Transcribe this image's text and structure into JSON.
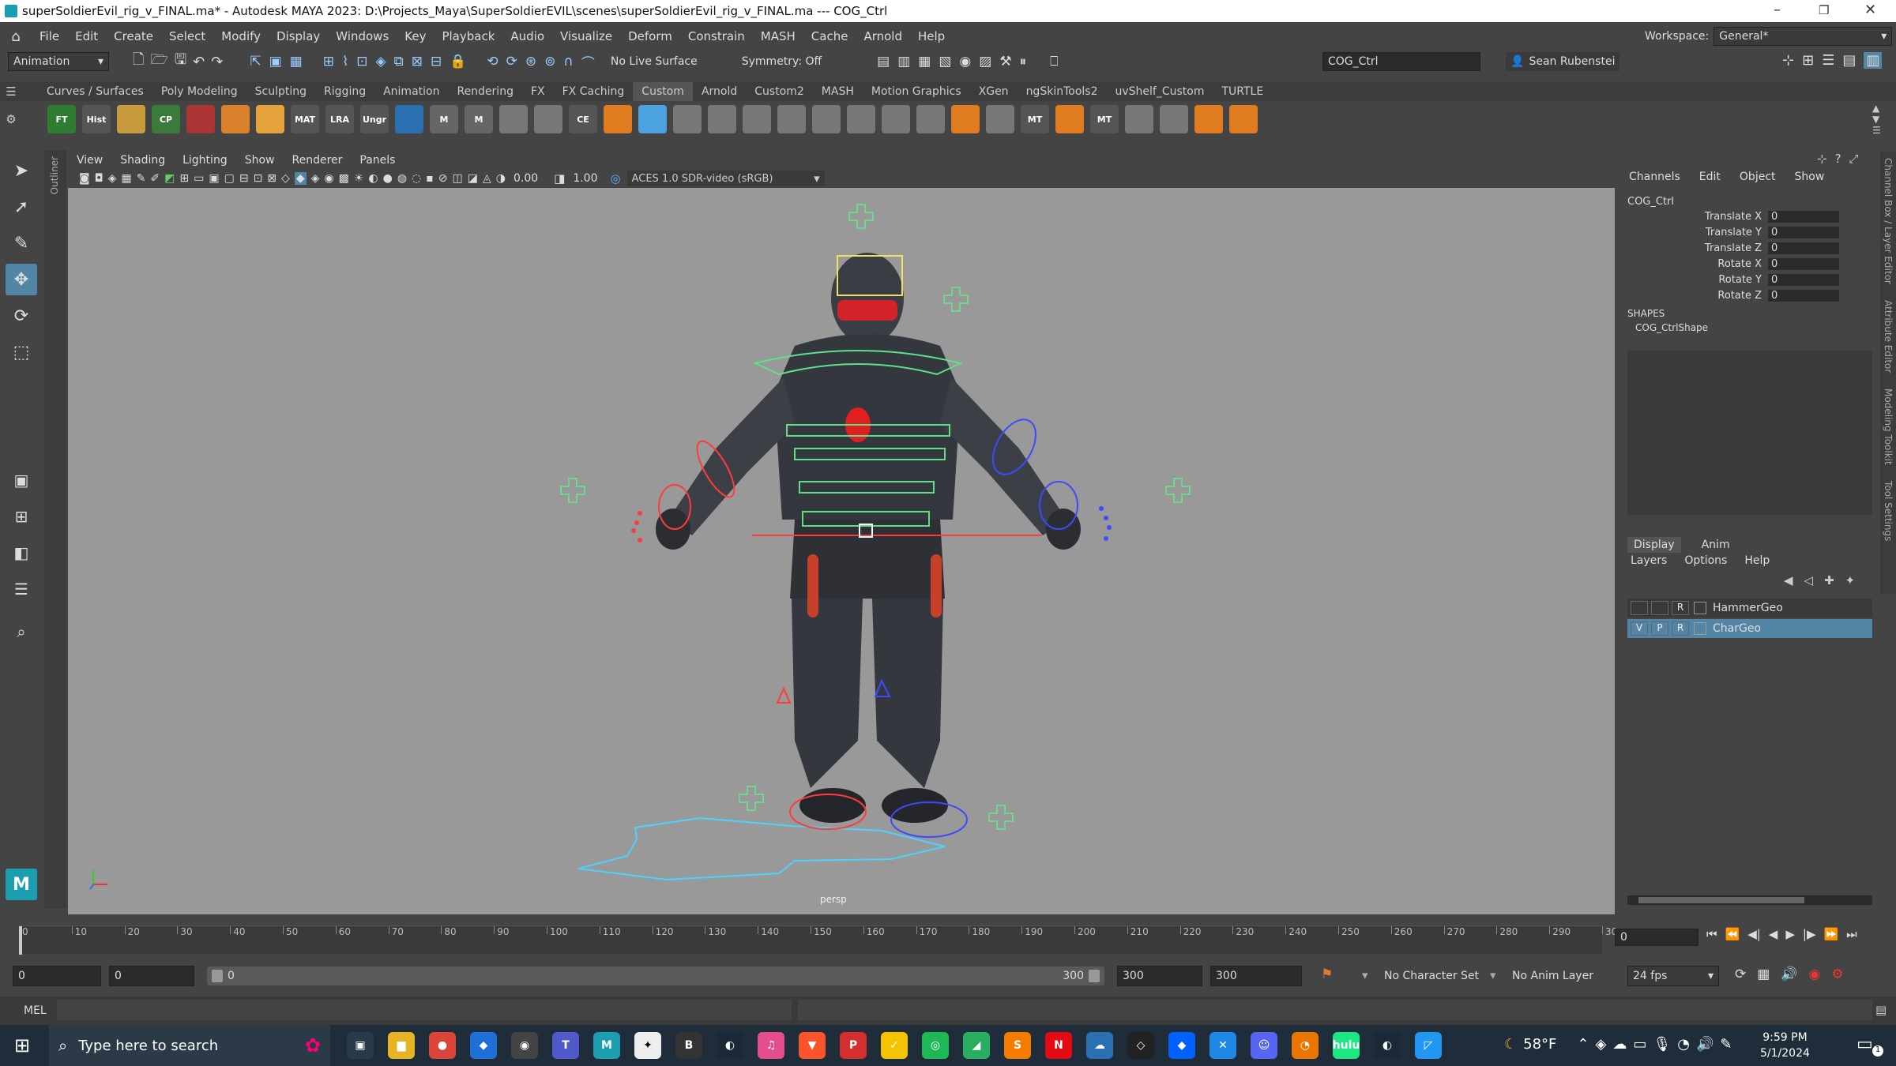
{
  "window": {
    "title": "superSoldierEvil_rig_v_FINAL.ma* - Autodesk MAYA 2023: D:\\Projects_Maya\\SuperSoldierEVIL\\scenes\\superSoldierEvil_rig_v_FINAL.ma  ---  COG_Ctrl"
  },
  "menubar": {
    "items": [
      "File",
      "Edit",
      "Create",
      "Select",
      "Modify",
      "Display",
      "Windows",
      "Key",
      "Playback",
      "Audio",
      "Visualize",
      "Deform",
      "Constrain",
      "MASH",
      "Cache",
      "Arnold",
      "Help"
    ],
    "workspace_label": "Workspace:",
    "workspace_value": "General*"
  },
  "statusline": {
    "menuset": "Animation",
    "live_surface": "No Live Surface",
    "symmetry": "Symmetry: Off",
    "object_field": "COG_Ctrl",
    "user": "Sean Rubenstein"
  },
  "shelf": {
    "tabs": [
      "Curves / Surfaces",
      "Poly Modeling",
      "Sculpting",
      "Rigging",
      "Animation",
      "Rendering",
      "FX",
      "FX Caching",
      "Custom",
      "Arnold",
      "Custom2",
      "MASH",
      "Motion Graphics",
      "XGen",
      "ngSkinTools2",
      "uvShelf_Custom",
      "TURTLE"
    ],
    "icons": [
      {
        "label": "FT",
        "color": "#2e7d32"
      },
      {
        "label": "Hist",
        "color": "#555"
      },
      {
        "label": "",
        "color": "#c89b3c"
      },
      {
        "label": "CP",
        "color": "#3a7a3a"
      },
      {
        "label": "",
        "color": "#a33"
      },
      {
        "label": "",
        "color": "#d9822b"
      },
      {
        "label": "",
        "color": "#e6a23c"
      },
      {
        "label": "MAT",
        "color": "#555"
      },
      {
        "label": "LRA",
        "color": "#555"
      },
      {
        "label": "Ungr",
        "color": "#555"
      },
      {
        "label": "",
        "color": "#2a6fb0"
      },
      {
        "label": "M",
        "color": "#666"
      },
      {
        "label": "M",
        "color": "#666"
      },
      {
        "label": "",
        "color": "#777"
      },
      {
        "label": "",
        "color": "#777"
      },
      {
        "label": "CE",
        "color": "#555"
      },
      {
        "label": "",
        "color": "#e07b1f"
      },
      {
        "label": "",
        "color": "#4aa3df"
      },
      {
        "label": "",
        "color": "#777"
      },
      {
        "label": "",
        "color": "#777"
      },
      {
        "label": "",
        "color": "#777"
      },
      {
        "label": "",
        "color": "#777"
      },
      {
        "label": "",
        "color": "#777"
      },
      {
        "label": "",
        "color": "#777"
      },
      {
        "label": "",
        "color": "#777"
      },
      {
        "label": "",
        "color": "#777"
      },
      {
        "label": "",
        "color": "#e07b1f"
      },
      {
        "label": "",
        "color": "#777"
      },
      {
        "label": "MT",
        "color": "#555"
      },
      {
        "label": "",
        "color": "#e07b1f"
      },
      {
        "label": "MT",
        "color": "#555"
      },
      {
        "label": "",
        "color": "#777"
      },
      {
        "label": "",
        "color": "#777"
      },
      {
        "label": "",
        "color": "#e07b1f"
      },
      {
        "label": "",
        "color": "#e07b1f"
      }
    ]
  },
  "viewport": {
    "menu": [
      "View",
      "Shading",
      "Lighting",
      "Show",
      "Renderer",
      "Panels"
    ],
    "exposure": "0.00",
    "gamma": "1.00",
    "color_space": "ACES 1.0 SDR-video (sRGB)",
    "camera_label": "persp"
  },
  "channelbox": {
    "menu": [
      "Channels",
      "Edit",
      "Object",
      "Show"
    ],
    "object": "COG_Ctrl",
    "channels": [
      {
        "name": "Translate X",
        "value": "0"
      },
      {
        "name": "Translate Y",
        "value": "0"
      },
      {
        "name": "Translate Z",
        "value": "0"
      },
      {
        "name": "Rotate X",
        "value": "0"
      },
      {
        "name": "Rotate Y",
        "value": "0"
      },
      {
        "name": "Rotate Z",
        "value": "0"
      }
    ],
    "shapes_header": "SHAPES",
    "shape": "COG_CtrlShape",
    "side_tabs": [
      "Channel Box / Layer Editor",
      "Attribute Editor",
      "Modeling Toolkit",
      "Tool Settings"
    ]
  },
  "layers": {
    "tabs": [
      "Display",
      "Anim"
    ],
    "menu": [
      "Layers",
      "Options",
      "Help"
    ],
    "rows": [
      {
        "v": "",
        "p": "",
        "r": "R",
        "name": "HammerGeo",
        "selected": false
      },
      {
        "v": "V",
        "p": "P",
        "r": "R",
        "name": "CharGeo",
        "selected": true
      }
    ]
  },
  "timeslider": {
    "ticks": [
      "0",
      "10",
      "20",
      "30",
      "40",
      "50",
      "60",
      "70",
      "80",
      "90",
      "100",
      "110",
      "120",
      "130",
      "140",
      "150",
      "160",
      "170",
      "180",
      "190",
      "200",
      "210",
      "220",
      "230",
      "240",
      "250",
      "260",
      "270",
      "280",
      "290",
      "30"
    ],
    "current_frame": "0"
  },
  "range": {
    "start": "0",
    "inner_start": "0",
    "slider_start": "0",
    "slider_end": "300",
    "inner_end": "300",
    "end": "300",
    "character_set": "No Character Set",
    "anim_layer": "No Anim Layer",
    "fps": "24 fps"
  },
  "cmdline": {
    "lang": "MEL"
  },
  "taskbar": {
    "search_placeholder": "Type here to search",
    "weather": "58°F",
    "time": "9:59 PM",
    "date": "5/1/2024",
    "notification_count": "1",
    "apps": [
      {
        "name": "task-view",
        "color": "#2b3a4a",
        "glyph": "▣"
      },
      {
        "name": "file-explorer",
        "color": "#e6b422",
        "glyph": "▆"
      },
      {
        "name": "chrome",
        "color": "#db4437",
        "glyph": "●"
      },
      {
        "name": "security",
        "color": "#1e6fd9",
        "glyph": "◆"
      },
      {
        "name": "obs",
        "color": "#444",
        "glyph": "◉"
      },
      {
        "name": "teams",
        "color": "#5059c9",
        "glyph": "T"
      },
      {
        "name": "maya",
        "color": "#1b9fb0",
        "glyph": "M"
      },
      {
        "name": "substance",
        "color": "#eee",
        "glyph": "✦"
      },
      {
        "name": "bandcamp",
        "color": "#333",
        "glyph": "B"
      },
      {
        "name": "steam",
        "color": "#1b2838",
        "glyph": "◐"
      },
      {
        "name": "itunes",
        "color": "#e44d8f",
        "glyph": "♫"
      },
      {
        "name": "brave",
        "color": "#fb542b",
        "glyph": "▼"
      },
      {
        "name": "pdf",
        "color": "#d32f2f",
        "glyph": "P"
      },
      {
        "name": "norton",
        "color": "#f5c400",
        "glyph": "✓"
      },
      {
        "name": "spotify",
        "color": "#1db954",
        "glyph": "◎"
      },
      {
        "name": "app-green",
        "color": "#27ae60",
        "glyph": "◢"
      },
      {
        "name": "sublime",
        "color": "#f57c00",
        "glyph": "S"
      },
      {
        "name": "netflix",
        "color": "#e50914",
        "glyph": "N"
      },
      {
        "name": "onedrive",
        "color": "#2a6fb0",
        "glyph": "☁"
      },
      {
        "name": "unity",
        "color": "#222",
        "glyph": "◇"
      },
      {
        "name": "dropbox",
        "color": "#0061ff",
        "glyph": "◆"
      },
      {
        "name": "app-blue",
        "color": "#1e88e5",
        "glyph": "✕"
      },
      {
        "name": "discord",
        "color": "#5865f2",
        "glyph": "☺"
      },
      {
        "name": "blender",
        "color": "#ea7600",
        "glyph": "◔"
      },
      {
        "name": "hulu",
        "color": "#1ce783",
        "glyph": "hulu"
      },
      {
        "name": "steam2",
        "color": "#1b2838",
        "glyph": "◐"
      },
      {
        "name": "app-cyan",
        "color": "#2196f3",
        "glyph": "◸"
      }
    ]
  }
}
